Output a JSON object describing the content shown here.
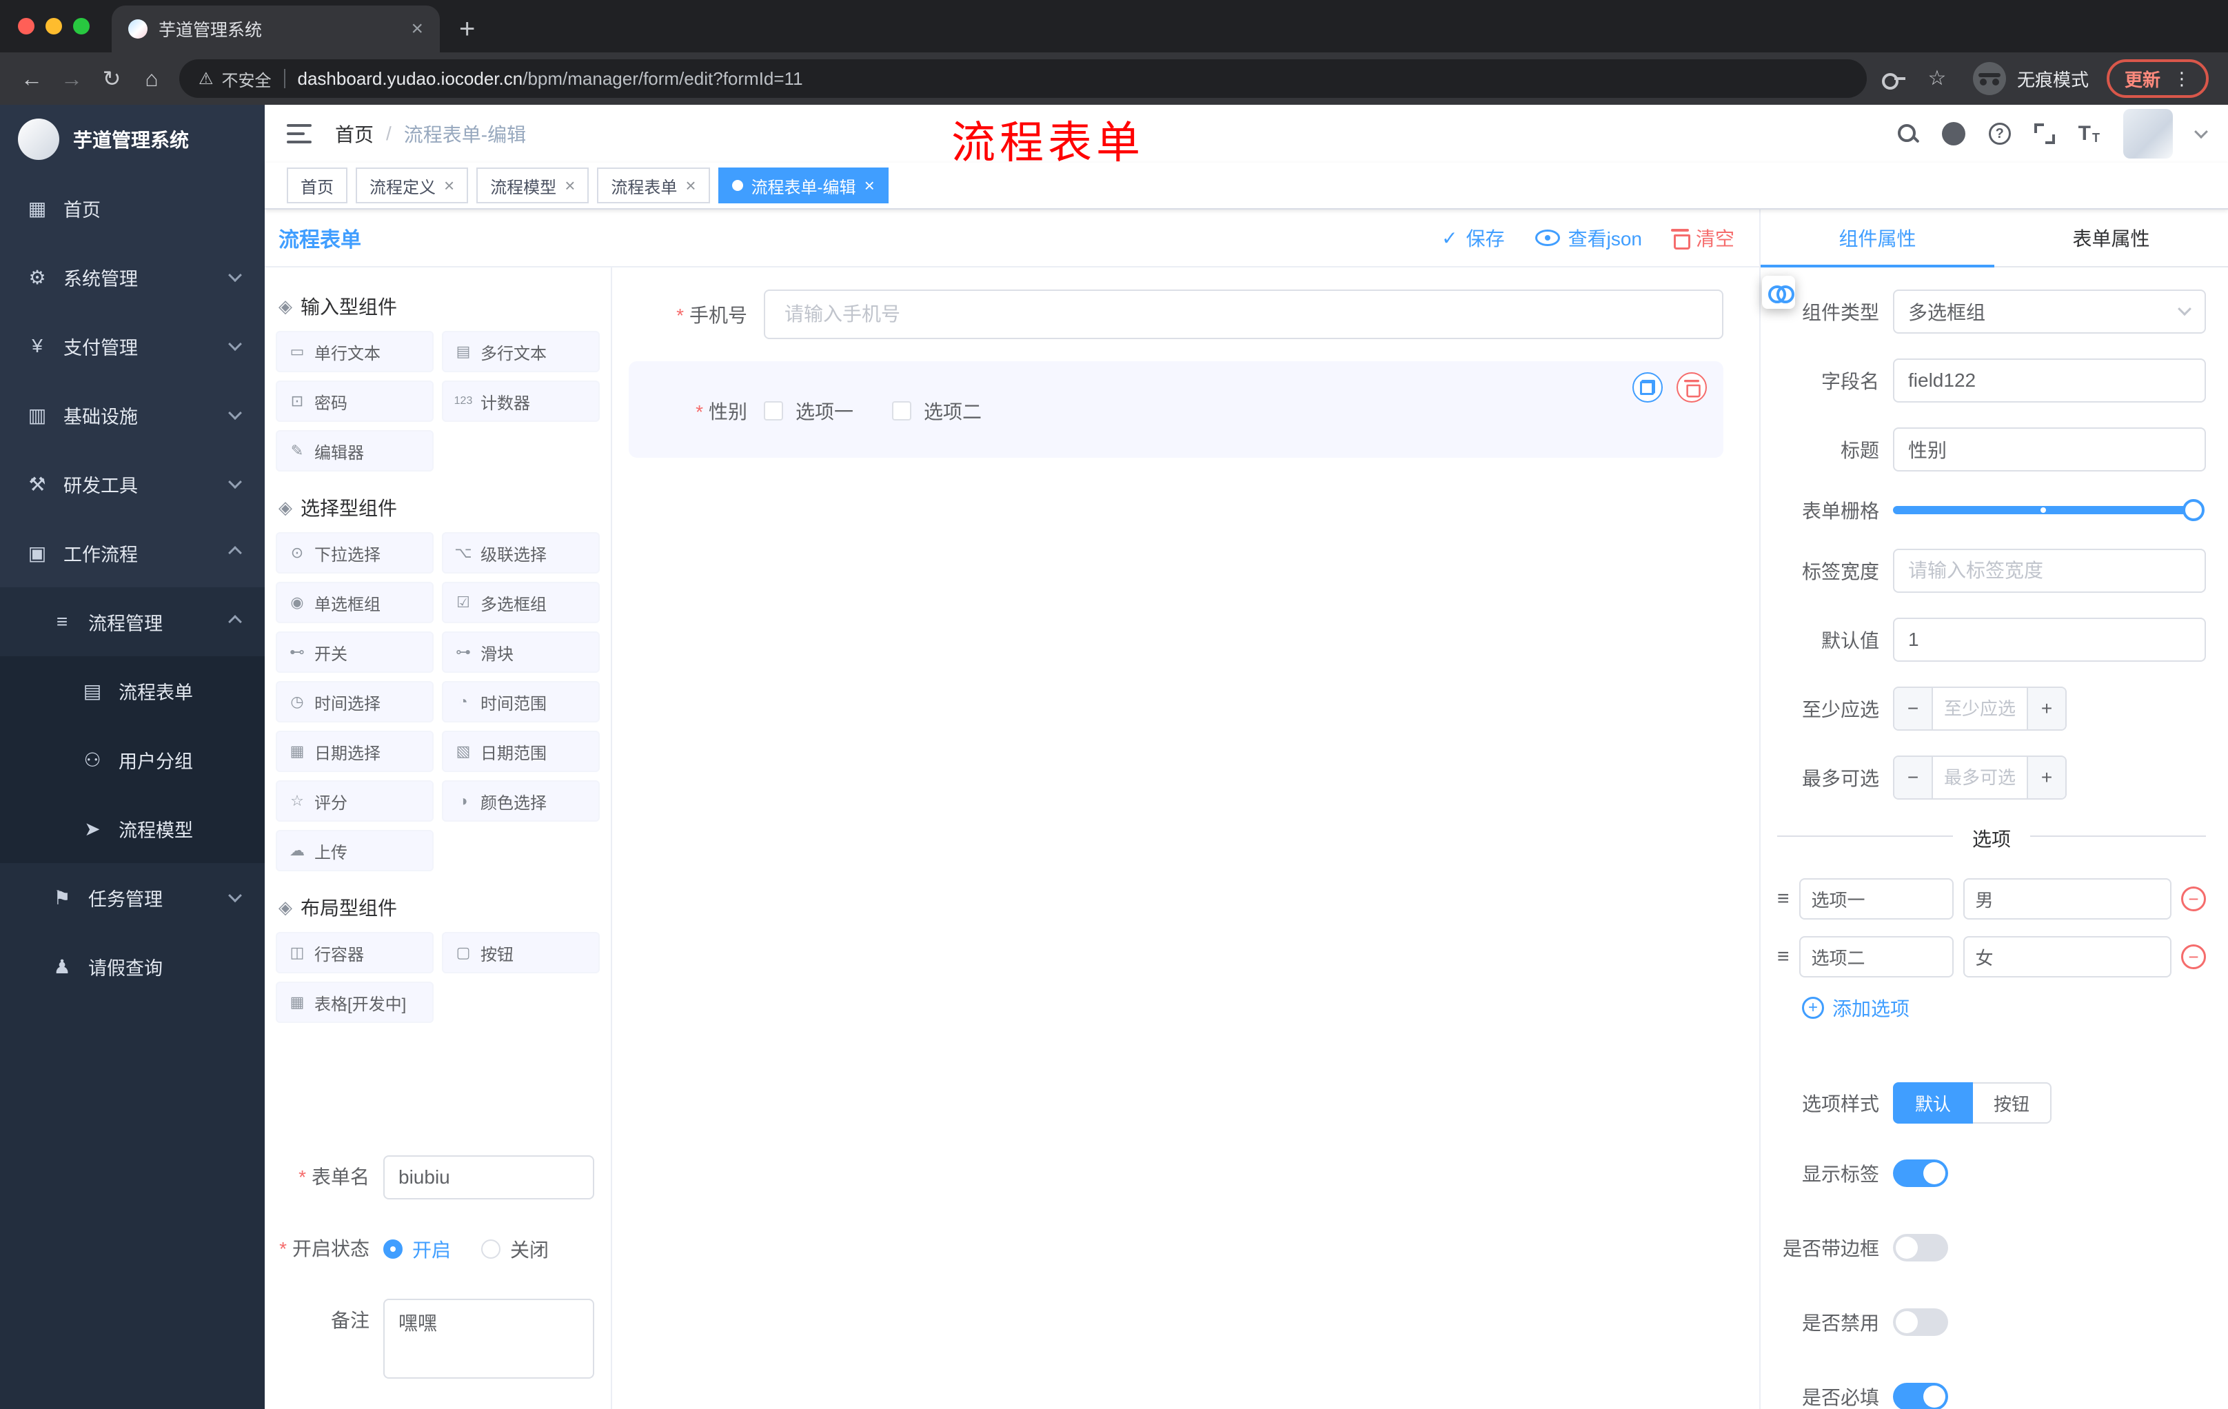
{
  "colors": {
    "primary": "#409EFF",
    "danger": "#F56C6C",
    "annotation_red": "#FF0000",
    "sidebar_bg": "#2B3648"
  },
  "icons": {
    "back": "←",
    "forward": "→",
    "reload": "↻",
    "home": "⌂",
    "warning": "⚠",
    "star": "☆",
    "menu_dots": "⋮",
    "close": "×",
    "new_tab": "+",
    "option_handle": "≡",
    "minus": "−",
    "plus": "+",
    "section": "◈"
  },
  "browser": {
    "tab_title": "芋道管理系统",
    "security_label": "不安全",
    "url_host": "dashboard.yudao.iocoder.cn",
    "url_path": "/bpm/manager/form/edit?formId=11",
    "incognito_label": "无痕模式",
    "update_label": "更新"
  },
  "sidebar": {
    "logo_title": "芋道管理系统",
    "menu": [
      {
        "label": "首页",
        "glyph": "▦"
      },
      {
        "label": "系统管理",
        "glyph": "⚙"
      },
      {
        "label": "支付管理",
        "glyph": "¥"
      },
      {
        "label": "基础设施",
        "glyph": "▥"
      },
      {
        "label": "研发工具",
        "glyph": "⚒"
      },
      {
        "label": "工作流程",
        "glyph": "▣"
      },
      {
        "label": "流程管理",
        "glyph": "≡"
      },
      {
        "label": "流程表单",
        "glyph": "▤"
      },
      {
        "label": "用户分组",
        "glyph": "⚇"
      },
      {
        "label": "流程模型",
        "glyph": "➤"
      },
      {
        "label": "任务管理",
        "glyph": "⚑"
      },
      {
        "label": "请假查询",
        "glyph": "♟"
      }
    ]
  },
  "header": {
    "breadcrumb_home": "首页",
    "breadcrumb_sep": "/",
    "breadcrumb_current": "流程表单-编辑",
    "annotation": "流程表单"
  },
  "tags": [
    {
      "label": "首页"
    },
    {
      "label": "流程定义"
    },
    {
      "label": "流程模型"
    },
    {
      "label": "流程表单"
    },
    {
      "label": "流程表单-编辑"
    }
  ],
  "designer": {
    "page_title": "流程表单",
    "save": "保存",
    "view_json": "查看json",
    "clear": "清空",
    "groups": [
      {
        "title": "输入型组件",
        "items": [
          {
            "label": "单行文本",
            "glyph": "▭"
          },
          {
            "label": "多行文本",
            "glyph": "▤"
          },
          {
            "label": "密码",
            "glyph": "⊡"
          },
          {
            "label": "计数器",
            "glyph": "123"
          },
          {
            "label": "编辑器",
            "glyph": "✎"
          }
        ]
      },
      {
        "title": "选择型组件",
        "items": [
          {
            "label": "下拉选择",
            "glyph": "⊙"
          },
          {
            "label": "级联选择",
            "glyph": "⌥"
          },
          {
            "label": "单选框组",
            "glyph": "◉"
          },
          {
            "label": "多选框组",
            "glyph": "☑"
          },
          {
            "label": "开关",
            "glyph": "⊷"
          },
          {
            "label": "滑块",
            "glyph": "⊶"
          },
          {
            "label": "时间选择",
            "glyph": "◷"
          },
          {
            "label": "时间范围",
            "glyph": "◔"
          },
          {
            "label": "日期选择",
            "glyph": "▦"
          },
          {
            "label": "日期范围",
            "glyph": "▧"
          },
          {
            "label": "评分",
            "glyph": "☆"
          },
          {
            "label": "颜色选择",
            "glyph": "◑"
          },
          {
            "label": "上传",
            "glyph": "☁"
          }
        ]
      },
      {
        "title": "布局型组件",
        "items": [
          {
            "label": "行容器",
            "glyph": "◫"
          },
          {
            "label": "按钮",
            "glyph": "▢"
          },
          {
            "label": "表格[开发中]",
            "glyph": "▦"
          }
        ]
      }
    ],
    "meta_form": {
      "name_label": "表单名",
      "name_value": "biubiu",
      "status_label": "开启状态",
      "status_on": "开启",
      "status_off": "关闭",
      "remark_label": "备注",
      "remark_value": "嘿嘿"
    },
    "canvas": {
      "phone_label": "手机号",
      "phone_placeholder": "请输入手机号",
      "gender_label": "性别",
      "gender_option1": "选项一",
      "gender_option2": "选项二"
    }
  },
  "props": {
    "tab_component": "组件属性",
    "tab_form": "表单属性",
    "component_type_label": "组件类型",
    "component_type_value": "多选框组",
    "field_label": "字段名",
    "field_value": "field122",
    "title_label": "标题",
    "title_value": "性别",
    "grid_label": "表单栅格",
    "width_label": "标签宽度",
    "width_placeholder": "请输入标签宽度",
    "default_label": "默认值",
    "default_value": "1",
    "min_label": "至少应选",
    "min_placeholder": "至少应选",
    "max_label": "最多可选",
    "max_placeholder": "最多可选",
    "divider": "选项",
    "options": [
      {
        "label": "选项一",
        "value": "男"
      },
      {
        "label": "选项二",
        "value": "女"
      }
    ],
    "add_option": "添加选项",
    "style_label": "选项样式",
    "style_default": "默认",
    "style_button": "按钮",
    "switch_show_label": "显示标签",
    "switch_border": "是否带边框",
    "switch_disabled": "是否禁用",
    "switch_required": "是否必填"
  }
}
